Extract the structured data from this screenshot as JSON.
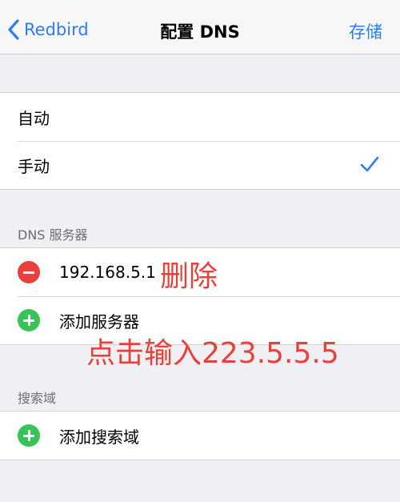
{
  "navbar": {
    "back_label": "Redbird",
    "title": "配置 DNS",
    "save_label": "存储"
  },
  "mode_options": [
    {
      "label": "自动",
      "selected": false
    },
    {
      "label": "手动",
      "selected": true
    }
  ],
  "dns_section": {
    "header": "DNS 服务器",
    "servers": [
      "192.168.5.1"
    ],
    "add_label": "添加服务器"
  },
  "search_section": {
    "header": "搜索域",
    "add_label": "添加搜索域"
  },
  "annotations": {
    "delete_note": "删除",
    "input_note": "点击输入223.5.5.5"
  },
  "colors": {
    "accent": "#2f7cf6",
    "remove": "#e8413a",
    "add": "#38c35a",
    "annotation": "#e8413a",
    "background": "#efeff4"
  }
}
